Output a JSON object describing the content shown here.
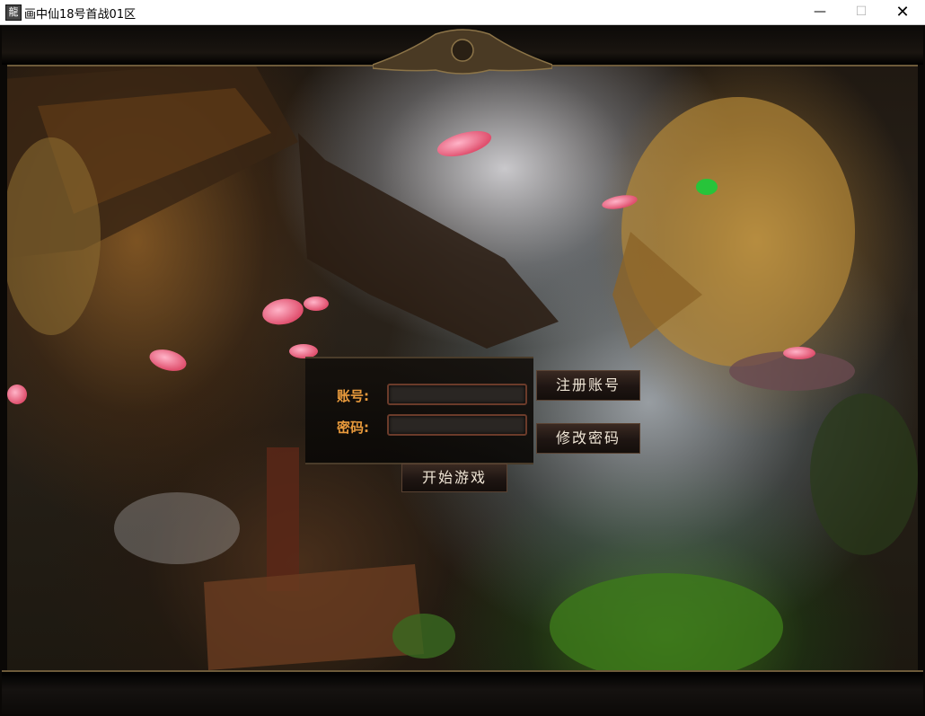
{
  "window": {
    "title": "画中仙18号首战01区",
    "app_icon": "game-logo-icon",
    "controls": {
      "minimize": "—",
      "maximize": "☐",
      "close": "✕"
    }
  },
  "login": {
    "account_label": "账号:",
    "password_label": "密码:",
    "account_value": "",
    "password_value": "",
    "register_button": "注册账号",
    "change_password_button": "修改密码",
    "start_button": "开始游戏"
  },
  "colors": {
    "label": "#e89a3c",
    "button_text": "#f0e6d6",
    "input_border": "#6b3b2a"
  }
}
